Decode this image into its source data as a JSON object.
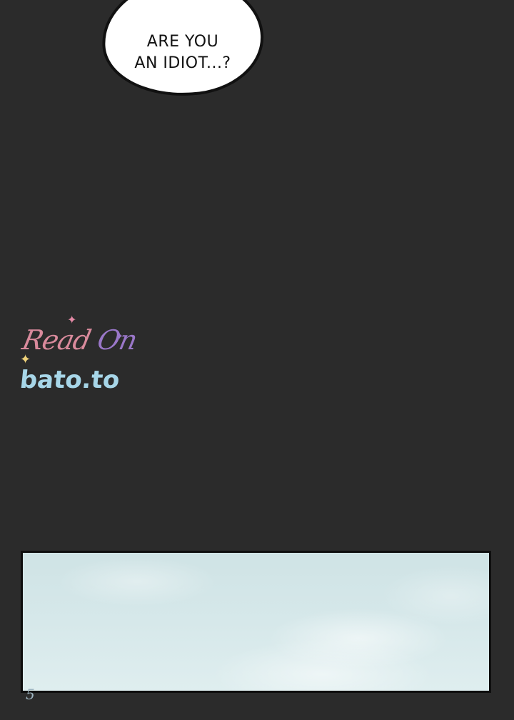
{
  "bubble": {
    "text": "ARE YOU\nAN IDIOT...?"
  },
  "watermark": {
    "line1_a": "Read",
    "line1_b": "On",
    "line2": "bato.to",
    "colors": {
      "read": "#d98a9c",
      "on": "#9a77c9",
      "site": "#a7d6e8"
    }
  },
  "page_number": "5",
  "colors": {
    "background": "#2b2b2b",
    "bubble_fill": "#ffffff",
    "bubble_border": "#111111",
    "panel_sky": "#d6e8ea"
  }
}
